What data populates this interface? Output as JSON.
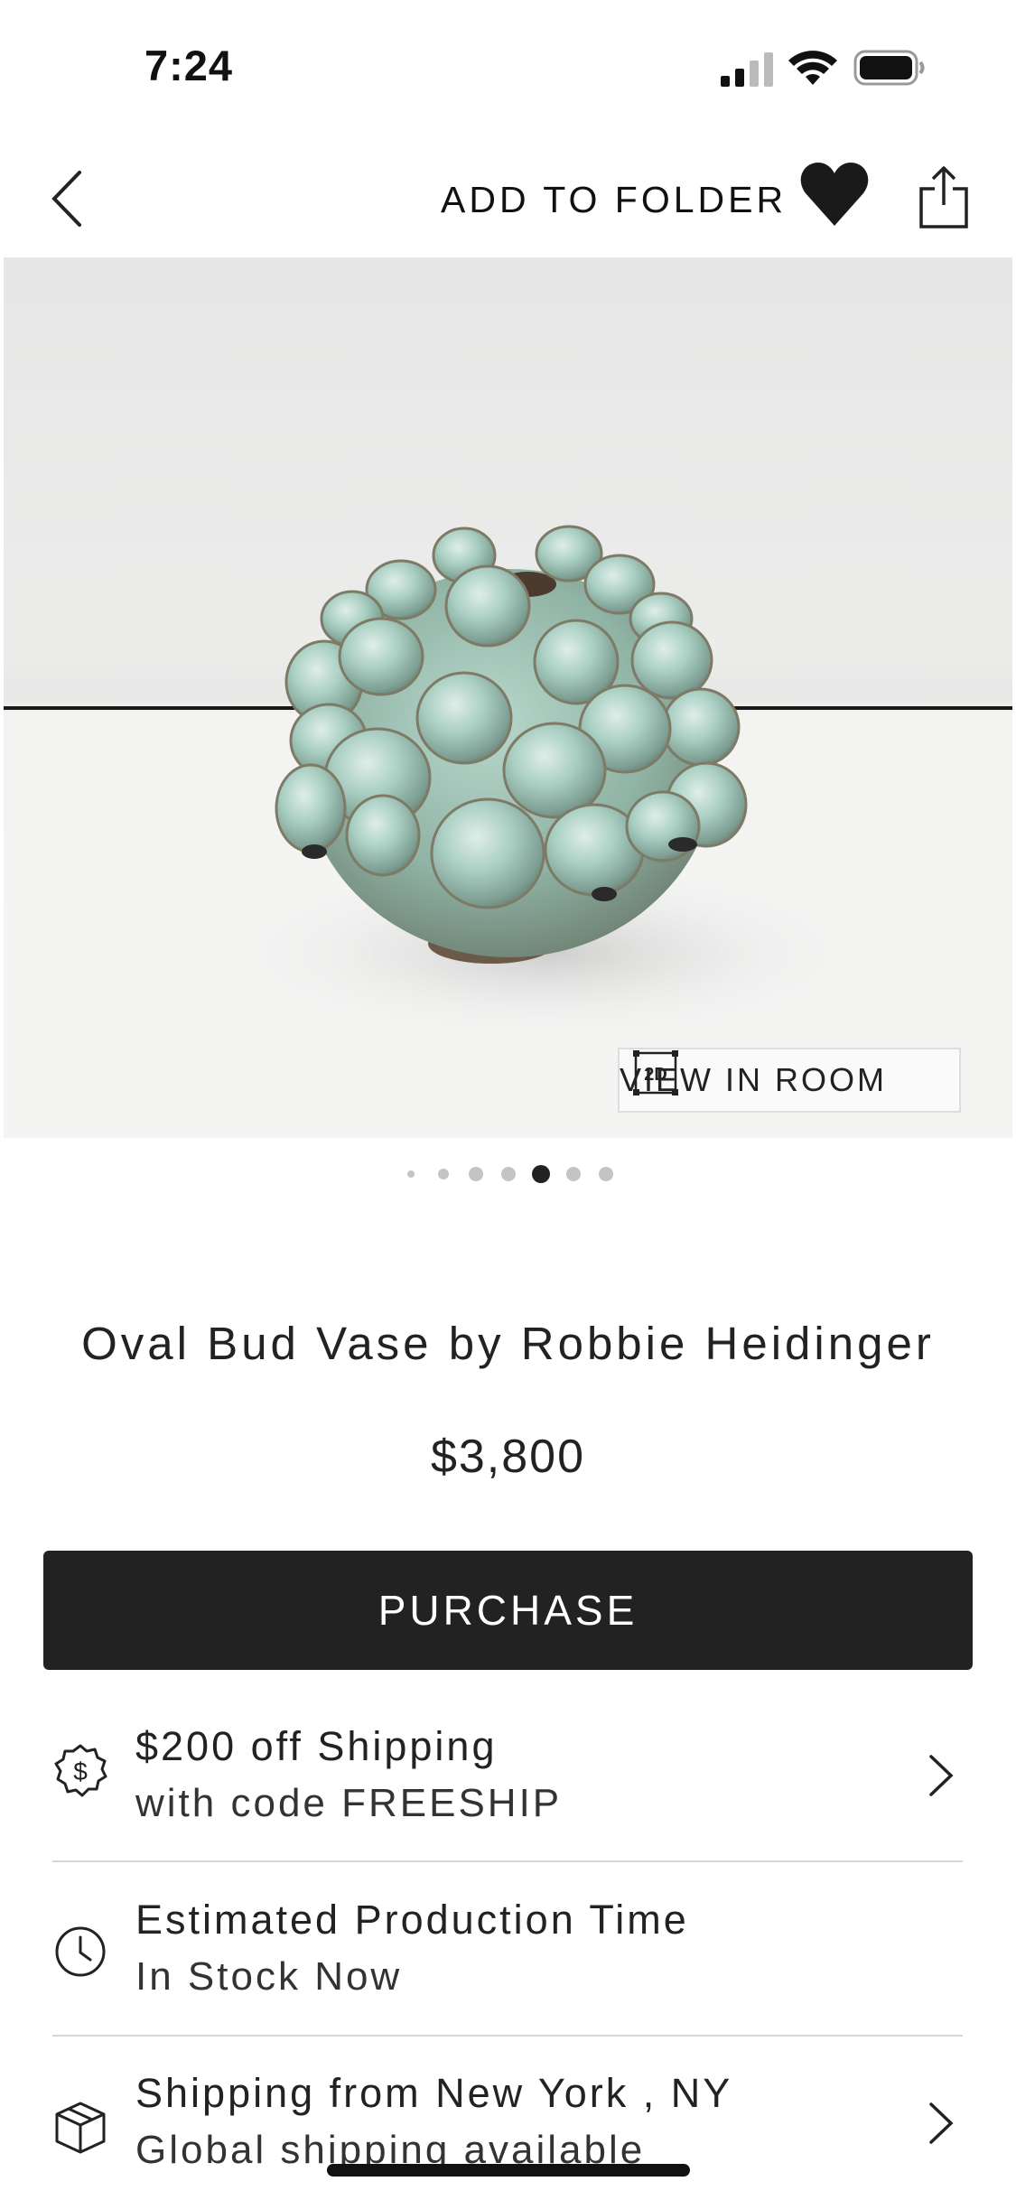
{
  "status_bar": {
    "time": "7:24"
  },
  "nav": {
    "add_to_folder": "ADD TO FOLDER"
  },
  "hero": {
    "view_in_room_label": "VIEW IN ROOM",
    "view_in_room_badge": "2D"
  },
  "carousel": {
    "count": 7,
    "active_index": 4
  },
  "product": {
    "title": "Oval Bud Vase by Robbie Heidinger",
    "price": "$3,800",
    "purchase_label": "PURCHASE"
  },
  "info_rows": [
    {
      "icon": "dollar-badge-icon",
      "title": "$200 off Shipping",
      "subtitle": "with code FREESHIP"
    },
    {
      "icon": "clock-icon",
      "title": "Estimated Production Time",
      "subtitle": "In Stock Now"
    },
    {
      "icon": "box-icon",
      "title": "Shipping from New York , NY",
      "subtitle": "Global shipping available"
    }
  ],
  "colors": {
    "primary_button": "#222222",
    "heart": "#1a1a1a",
    "vase": "#a9cfc2"
  }
}
